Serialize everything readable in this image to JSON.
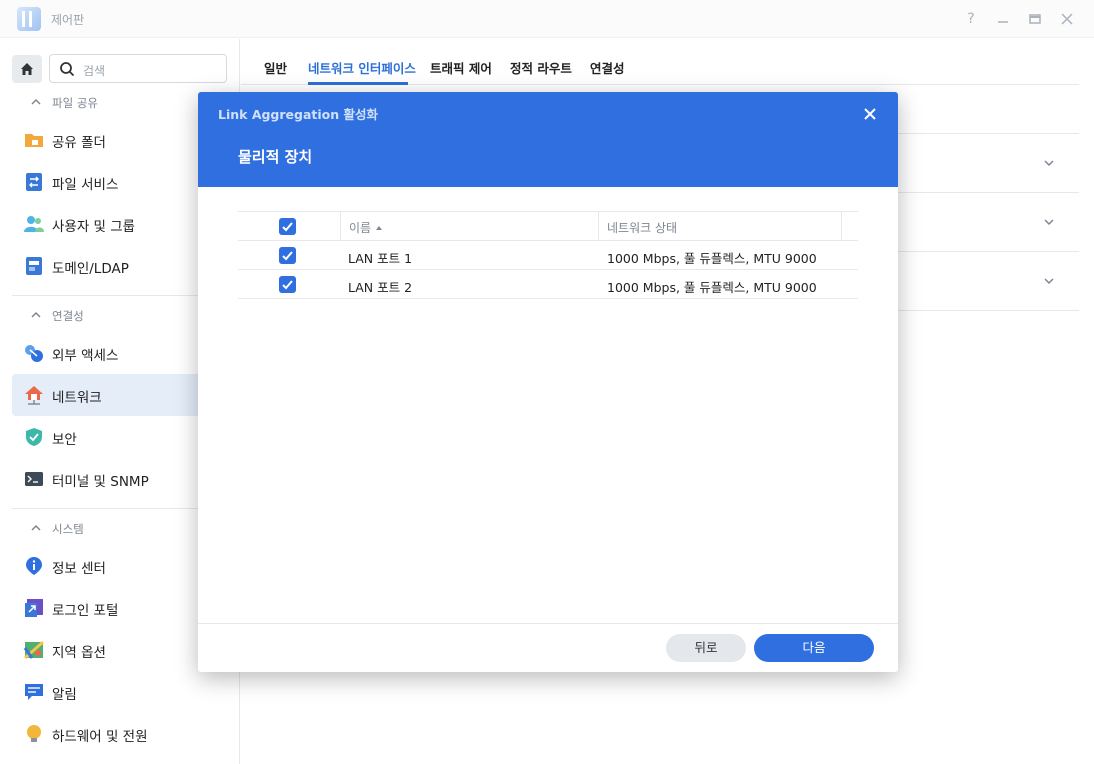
{
  "window": {
    "title": "제어판",
    "controls": [
      "help-icon",
      "minimize-icon",
      "maximize-icon",
      "close-icon"
    ]
  },
  "sidebar": {
    "search_placeholder": "검색",
    "sections": [
      {
        "label": "파일 공유",
        "items": [
          "공유 폴더",
          "파일 서비스",
          "사용자 및 그룹",
          "도메인/LDAP"
        ]
      },
      {
        "label": "연결성",
        "items": [
          "외부 액세스",
          "네트워크",
          "보안",
          "터미널 및 SNMP"
        ]
      },
      {
        "label": "시스템",
        "items": [
          "정보 센터",
          "로그인 포털",
          "지역 옵션",
          "알림",
          "하드웨어 및 전원"
        ]
      }
    ],
    "active_item": "네트워크"
  },
  "main": {
    "tabs": [
      "일반",
      "네트워크 인터페이스",
      "트래픽 제어",
      "정적 라우트",
      "연결성"
    ],
    "active_tab": "네트워크 인터페이스"
  },
  "modal": {
    "title": "Link Aggregation 활성화",
    "subtitle": "물리적 장치",
    "columns": {
      "name": "이름",
      "status": "네트워크 상태"
    },
    "rows": [
      {
        "checked": true,
        "name": "LAN 포트 1",
        "status": "1000 Mbps, 풀 듀플렉스, MTU 9000"
      },
      {
        "checked": true,
        "name": "LAN 포트 2",
        "status": "1000 Mbps, 풀 듀플렉스, MTU 9000"
      }
    ],
    "back_label": "뒤로",
    "next_label": "다음"
  },
  "colors": {
    "accent": "#2f6fdf",
    "active_nav_bg": "#e4edf8"
  }
}
